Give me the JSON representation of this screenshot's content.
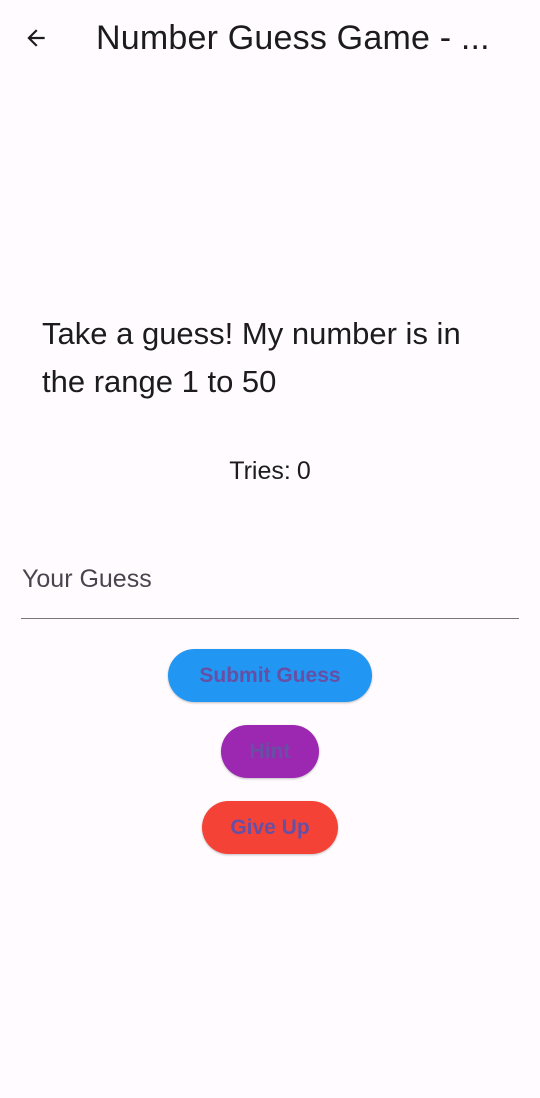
{
  "app_bar": {
    "title": "Number Guess Game - ...",
    "back_icon": "arrow-back-icon"
  },
  "game": {
    "prompt": "Take a guess! My number is in the range 1 to 50",
    "tries_label": "Tries:",
    "tries_count": "0"
  },
  "guess_input": {
    "placeholder": "Your Guess",
    "value": ""
  },
  "buttons": {
    "submit_label": "Submit Guess",
    "hint_label": "Hint",
    "give_up_label": "Give Up"
  },
  "colors": {
    "background": "#fffbfe",
    "submit": "#2196f3",
    "hint": "#9c27b0",
    "give_up": "#f44336",
    "button_text": "#6750a4"
  }
}
